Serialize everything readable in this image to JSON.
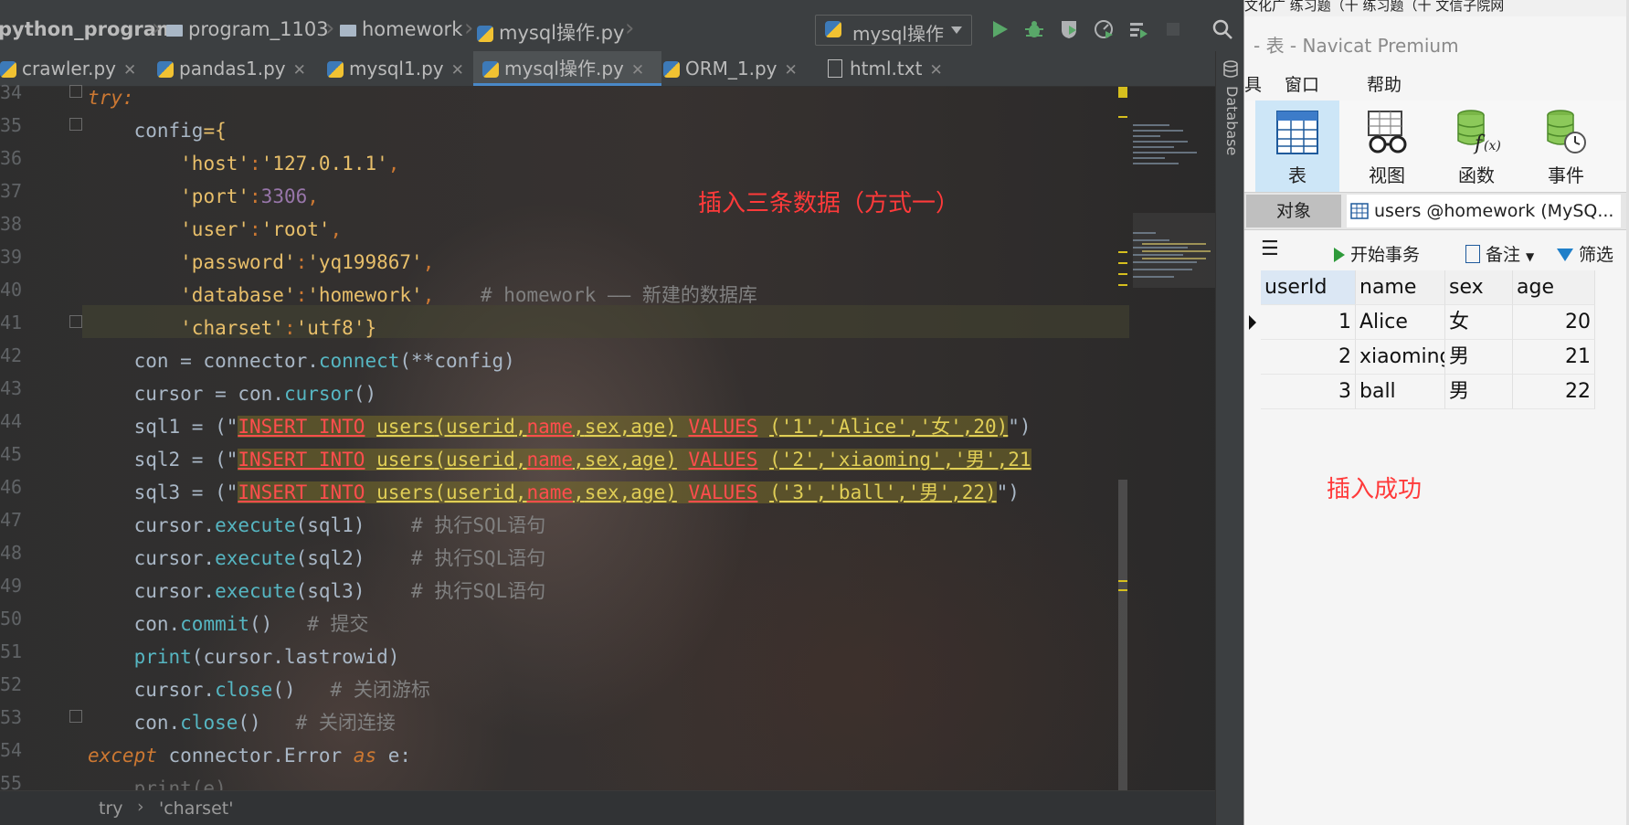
{
  "ide": {
    "breadcrumbs": [
      "python_program",
      "program_1103",
      "homework",
      "mysql操作.py"
    ],
    "run_config": "mysql操作",
    "tabs": [
      {
        "label": "crawler.py",
        "active": false
      },
      {
        "label": "pandas1.py",
        "active": false
      },
      {
        "label": "mysql1.py",
        "active": false
      },
      {
        "label": "mysql操作.py",
        "active": true
      },
      {
        "label": "ORM_1.py",
        "active": false
      },
      {
        "label": "html.txt",
        "active": false
      }
    ],
    "line_numbers": [
      "34",
      "35",
      "36",
      "37",
      "38",
      "39",
      "40",
      "41",
      "42",
      "43",
      "44",
      "45",
      "46",
      "47",
      "48",
      "49",
      "50",
      "51",
      "52",
      "53",
      "54",
      "55"
    ],
    "annotation": "插入三条数据（方式一）",
    "status_breadcrumb": [
      "try",
      "'charset'"
    ],
    "side_panel_label": "Database",
    "colors": {
      "accent": "#4a88c7",
      "annotation": "#ff3a3a",
      "background": "#2b2b2b"
    }
  },
  "code": {
    "l34_try": "try:",
    "l35_config": "config",
    "l35_eq": "={",
    "l36_key": "'host'",
    "l36_val": "'127.0.1.1'",
    "l37_key": "'port'",
    "l37_val": "3306",
    "l38_key": "'user'",
    "l38_val": "'root'",
    "l39_key": "'password'",
    "l39_val": "'yq199867'",
    "l40_key": "'database'",
    "l40_val": "'homework'",
    "l40_comment": "# homework —— 新建的数据库",
    "l41_key": "'charset'",
    "l41_val": "'utf8'",
    "l41_end": "}",
    "l42_a": "con = connector.",
    "l42_fn": "connect",
    "l42_b": "(**config)",
    "l43_a": "cursor = con.",
    "l43_fn": "cursor",
    "l43_b": "()",
    "sql_prefix": [
      "sql1 = (\"",
      "sql2 = (\"",
      "sql3 = (\""
    ],
    "sql_insert": "INSERT INTO",
    "sql_table": "users",
    "sql_cols_a": "(userid",
    "sql_cols_name": "name",
    "sql_cols_b": "sex,age)",
    "sql_values": "VALUES",
    "sql_vals": [
      "('1','Alice','女',20)",
      "('2','xiaoming','男',21",
      "('3','ball','男',22)"
    ],
    "sql_tail": [
      "\")",
      "",
      "\")"
    ],
    "exec_a": "cursor.",
    "exec_fn": "execute",
    "exec_args": [
      "(sql1)",
      "(sql2)",
      "(sql3)"
    ],
    "exec_comment": "# 执行SQL语句",
    "commit_a": "con.",
    "commit_fn": "commit",
    "commit_b": "()",
    "commit_comment": "# 提交",
    "print_fn": "print",
    "print_b": "(cursor.lastrowid)",
    "close1_a": "cursor.",
    "close_fn": "close",
    "close_b": "()",
    "close1_comment": "# 关闭游标",
    "close2_a": "con.",
    "close2_comment": "# 关闭连接",
    "l54_except": "except",
    "l54_a": " connector.Error ",
    "l54_as": "as",
    "l54_b": " e:",
    "l55": "print(e)"
  },
  "navicat": {
    "title": "- 表 - Navicat Premium",
    "top_clip": "文化广  练习题（十  练习题（十  文信子院网",
    "menu": [
      "具",
      "窗口",
      "帮助"
    ],
    "ribbon": [
      {
        "label": "表",
        "icon": "table-icon",
        "active": true
      },
      {
        "label": "视图",
        "icon": "view-icon",
        "active": false
      },
      {
        "label": "函数",
        "icon": "function-icon",
        "active": false
      },
      {
        "label": "事件",
        "icon": "event-icon",
        "active": false
      }
    ],
    "object_tab": "对象",
    "users_tab": "users @homework (MySQ...",
    "toolbar": {
      "begin_tx": "开始事务",
      "note": "备注",
      "filter": "筛选"
    },
    "columns": [
      "userId",
      "name",
      "sex",
      "age"
    ],
    "rows": [
      {
        "userId": "1",
        "name": "Alice",
        "sex": "女",
        "age": "20"
      },
      {
        "userId": "2",
        "name": "xiaoming",
        "sex": "男",
        "age": "21"
      },
      {
        "userId": "3",
        "name": "ball",
        "sex": "男",
        "age": "22"
      }
    ],
    "annotation": "插入成功",
    "colors": {
      "selected_header": "#dbe7f4",
      "ribbon_active": "#cde6f7"
    }
  }
}
